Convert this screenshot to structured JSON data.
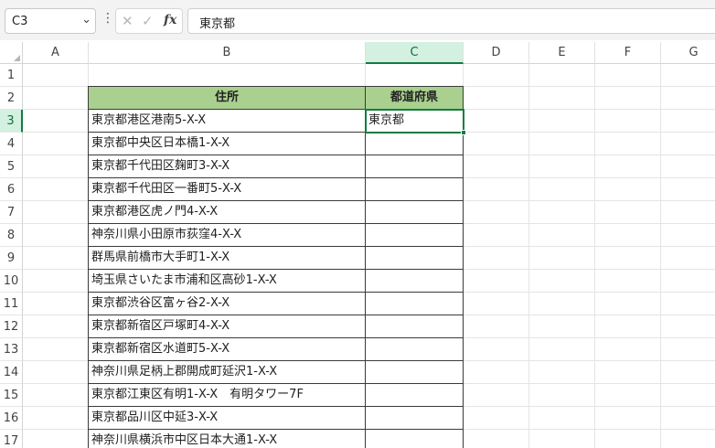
{
  "formula_bar": {
    "name_box": "C3",
    "formula": "東京都"
  },
  "columns": [
    "A",
    "B",
    "C",
    "D",
    "E",
    "F",
    "G"
  ],
  "selected_column": "C",
  "selected_row": 3,
  "rows": [
    "1",
    "2",
    "3",
    "4",
    "5",
    "6",
    "7",
    "8",
    "9",
    "10",
    "11",
    "12",
    "13",
    "14",
    "15",
    "16",
    "17"
  ],
  "table": {
    "headers": [
      "住所",
      "都道府県"
    ],
    "addresses": [
      "東京都港区港南5-X-X",
      "東京都中央区日本橋1-X-X",
      "東京都千代田区麹町3-X-X",
      "東京都千代田区一番町5-X-X",
      "東京都港区虎ノ門4-X-X",
      "神奈川県小田原市荻窪4-X-X",
      "群馬県前橋市大手町1-X-X",
      "埼玉県さいたま市浦和区高砂1-X-X",
      "東京都渋谷区富ヶ谷2-X-X",
      "東京都新宿区戸塚町4-X-X",
      "東京都新宿区水道町5-X-X",
      "神奈川県足柄上郡開成町延沢1-X-X",
      "東京都江東区有明1-X-X　有明タワー7F",
      "東京都品川区中延3-X-X",
      "神奈川県横浜市中区日本大通1-X-X"
    ],
    "prefectures": [
      "東京都",
      "",
      "",
      "",
      "",
      "",
      "",
      "",
      "",
      "",
      "",
      "",
      "",
      "",
      ""
    ]
  },
  "colors": {
    "header_fill": "#a9d08e",
    "selection_green": "#107c41"
  }
}
